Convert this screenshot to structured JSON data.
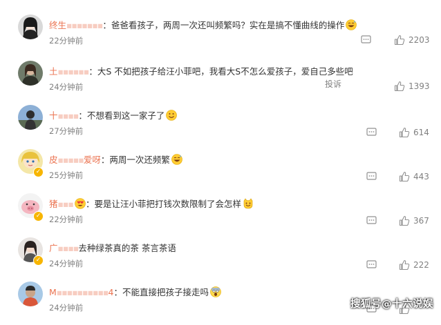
{
  "comments": [
    {
      "user_visible": "终生",
      "user_masked": "▪▪▪▪▪▪▪",
      "separator": "：",
      "text": "爸爸看孩子，两周一次还叫频繁吗？实在是搞不懂曲线的操作",
      "time": "22分钟前",
      "likes": "2203",
      "emoji": "grinning-sweat-emoji",
      "avatar": "avatar-anime-girl"
    },
    {
      "user_visible": "土",
      "user_masked": "▪▪▪▪▪▪",
      "separator": "：",
      "text": "大S 不如把孩子给汪小菲吧，我看大S不怎么爱孩子，爱自己多些吧",
      "time": "24分钟前",
      "likes": "1393",
      "report": "投诉",
      "avatar": "avatar-photo-woman"
    },
    {
      "user_visible": "十",
      "user_masked": "▪▪▪▪",
      "separator": "：",
      "text": "不想看到这一家子了",
      "time": "27分钟前",
      "likes": "614",
      "emoji": "smiling-emoji",
      "avatar": "avatar-photo-person"
    },
    {
      "user_visible": "皮",
      "user_masked": "▪▪▪▪▪",
      "user_visible_tail": "爱呀",
      "separator": "：",
      "text": "两周一次还频繁",
      "time": "25分钟前",
      "likes": "443",
      "emoji": "grinning-sweat-emoji",
      "avatar": "avatar-cartoon-girl",
      "verified": true
    },
    {
      "user_visible": "猪",
      "user_masked": "▪▪▪",
      "separator": "：",
      "text": "要是让汪小菲把打钱次数限制了会怎样",
      "time": "22分钟前",
      "likes": "367",
      "emoji": "cat-face-emoji",
      "name_emoji": "heart-eyes-emoji",
      "avatar": "avatar-pink-pig",
      "verified": true
    },
    {
      "user_visible": "广",
      "user_masked": "▪▪▪▪",
      "separator": "",
      "text": "去种绿茶真的茶 茶言茶语",
      "time": "24分钟前",
      "likes": "222",
      "avatar": "avatar-photo-girl",
      "verified": true
    },
    {
      "user_visible": "M",
      "user_masked": "▪▪▪▪▪▪▪▪▪▪",
      "user_visible_tail": "4",
      "separator": "：",
      "text": "不能直接把孩子接走吗",
      "time": "24分钟前",
      "likes": "",
      "emoji": "scared-face-emoji",
      "avatar": "avatar-photo-man"
    }
  ],
  "watermark": "搜狐号@十六说娱",
  "colors": {
    "username": "#eb7350",
    "meta": "#808080",
    "text": "#333333"
  }
}
